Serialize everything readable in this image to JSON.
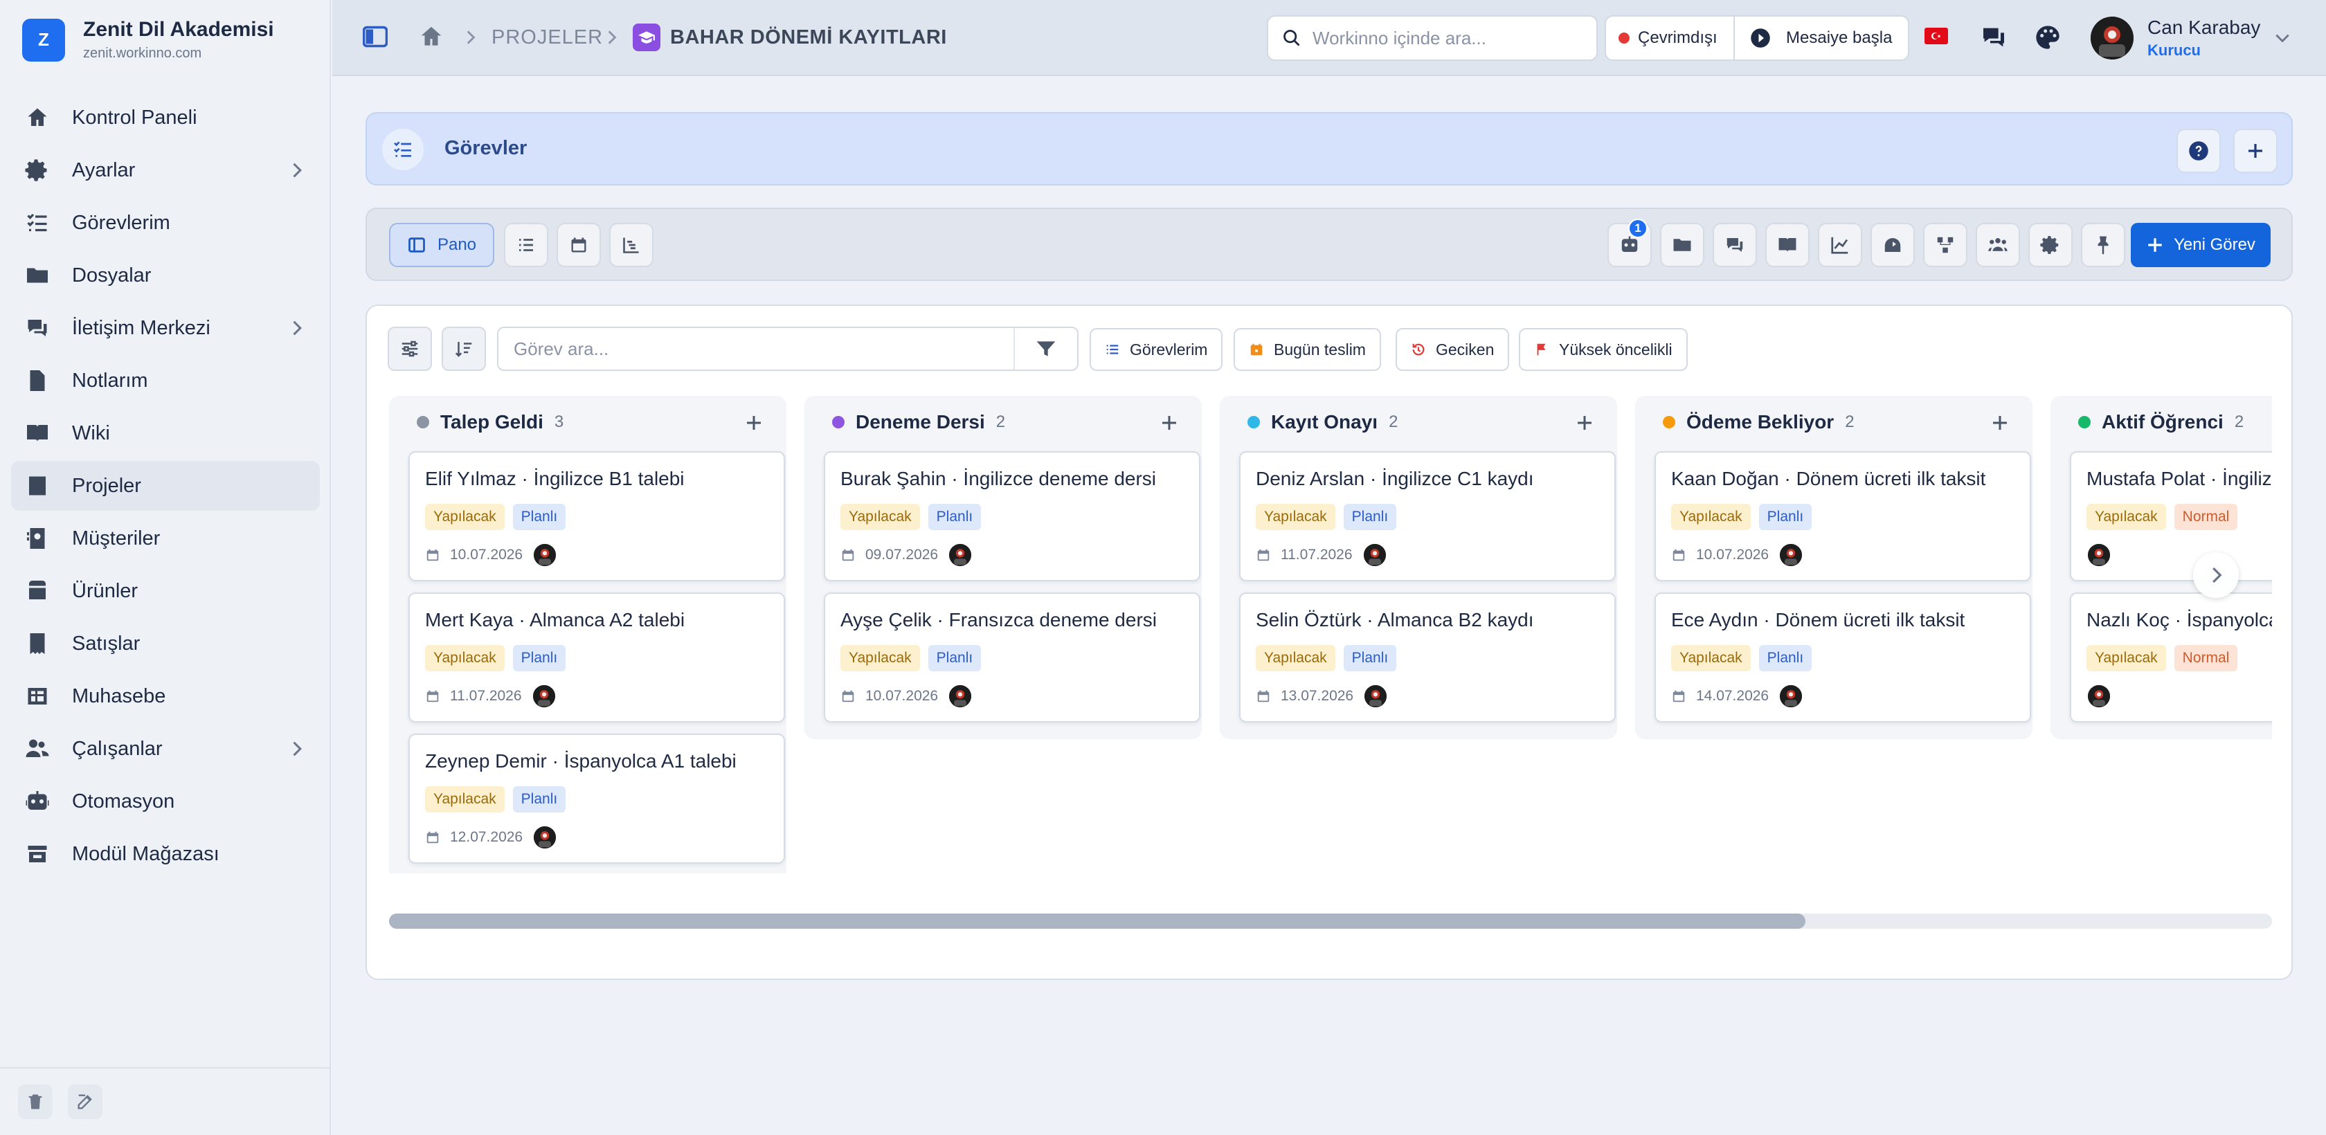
{
  "brand": {
    "logo_letter": "Z",
    "name": "Zenit Dil Akademisi",
    "domain": "zenit.workinno.com"
  },
  "sidebar": {
    "items": [
      {
        "label": "Kontrol Paneli",
        "icon": "home-icon",
        "chevron": false,
        "active": false
      },
      {
        "label": "Ayarlar",
        "icon": "gear-icon",
        "chevron": true,
        "active": false
      },
      {
        "label": "Görevlerim",
        "icon": "task-list-icon",
        "chevron": false,
        "active": false
      },
      {
        "label": "Dosyalar",
        "icon": "folder-icon",
        "chevron": false,
        "active": false
      },
      {
        "label": "İletişim Merkezi",
        "icon": "chat-icon",
        "chevron": true,
        "active": false
      },
      {
        "label": "Notlarım",
        "icon": "note-icon",
        "chevron": false,
        "active": false
      },
      {
        "label": "Wiki",
        "icon": "book-icon",
        "chevron": false,
        "active": false
      },
      {
        "label": "Projeler",
        "icon": "projects-icon",
        "chevron": false,
        "active": true
      },
      {
        "label": "Müşteriler",
        "icon": "contact-icon",
        "chevron": false,
        "active": false
      },
      {
        "label": "Ürünler",
        "icon": "box-icon",
        "chevron": false,
        "active": false
      },
      {
        "label": "Satışlar",
        "icon": "receipt-icon",
        "chevron": false,
        "active": false
      },
      {
        "label": "Muhasebe",
        "icon": "accounting-icon",
        "chevron": false,
        "active": false
      },
      {
        "label": "Çalışanlar",
        "icon": "users-icon",
        "chevron": true,
        "active": false
      },
      {
        "label": "Otomasyon",
        "icon": "robot-icon",
        "chevron": false,
        "active": false
      },
      {
        "label": "Modül Mağazası",
        "icon": "store-icon",
        "chevron": false,
        "active": false
      }
    ]
  },
  "topbar": {
    "breadcrumb_projects": "PROJELER",
    "breadcrumb_current": "BAHAR DÖNEMİ KAYITLARI",
    "search_placeholder": "Workinno içinde ara...",
    "status_offline": "Çevrimdışı",
    "start_shift": "Mesaiye başla",
    "user_name": "Can Karabay",
    "user_role": "Kurucu"
  },
  "page_header": {
    "title": "Görevler"
  },
  "toolbar": {
    "board_view": "Pano",
    "badge_count": "1",
    "new_task": "Yeni Görev"
  },
  "board": {
    "search_placeholder": "Görev ara...",
    "chips": [
      "Görevlerim",
      "Bugün teslim",
      "Geciken",
      "Yüksek öncelikli"
    ],
    "columns": [
      {
        "title": "Talep Geldi",
        "count": "3",
        "color": "#8c94a3",
        "cards": [
          {
            "title": "Elif Yılmaz · İngilizce B1 talebi",
            "status": "Yapılacak",
            "type": "Planlı",
            "date": "10.07.2026"
          },
          {
            "title": "Mert Kaya · Almanca A2 talebi",
            "status": "Yapılacak",
            "type": "Planlı",
            "date": "11.07.2026"
          },
          {
            "title": "Zeynep Demir · İspanyolca A1 talebi",
            "status": "Yapılacak",
            "type": "Planlı",
            "date": "12.07.2026"
          }
        ]
      },
      {
        "title": "Deneme Dersi",
        "count": "2",
        "color": "#8e55e0",
        "cards": [
          {
            "title": "Burak Şahin · İngilizce deneme dersi",
            "status": "Yapılacak",
            "type": "Planlı",
            "date": "09.07.2026"
          },
          {
            "title": "Ayşe Çelik · Fransızca deneme dersi",
            "status": "Yapılacak",
            "type": "Planlı",
            "date": "10.07.2026"
          }
        ]
      },
      {
        "title": "Kayıt Onayı",
        "count": "2",
        "color": "#2fb7e8",
        "cards": [
          {
            "title": "Deniz Arslan · İngilizce C1 kaydı",
            "status": "Yapılacak",
            "type": "Planlı",
            "date": "11.07.2026"
          },
          {
            "title": "Selin Öztürk · Almanca B2 kaydı",
            "status": "Yapılacak",
            "type": "Planlı",
            "date": "13.07.2026"
          }
        ]
      },
      {
        "title": "Ödeme Bekliyor",
        "count": "2",
        "color": "#f59a0c",
        "cards": [
          {
            "title": "Kaan Doğan · Dönem ücreti ilk taksit",
            "status": "Yapılacak",
            "type": "Planlı",
            "date": "10.07.2026"
          },
          {
            "title": "Ece Aydın · Dönem ücreti ilk taksit",
            "status": "Yapılacak",
            "type": "Planlı",
            "date": "14.07.2026"
          }
        ]
      },
      {
        "title": "Aktif Öğrenci",
        "count": "2",
        "color": "#16b86a",
        "cards": [
          {
            "title": "Mustafa Polat · İngilizce",
            "status": "Yapılacak",
            "type": "Normal",
            "date": ""
          },
          {
            "title": "Nazlı Koç · İspanyolca",
            "status": "Yapılacak",
            "type": "Normal",
            "date": ""
          }
        ]
      }
    ]
  },
  "colors": {
    "accent": "#1f6ef0",
    "project_icon": "#8a4fe0",
    "offline": "#e53935"
  }
}
